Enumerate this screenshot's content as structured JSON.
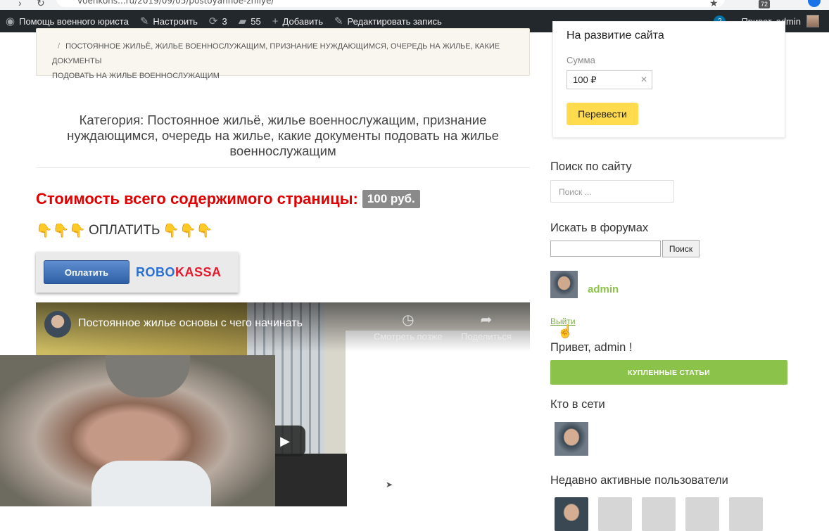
{
  "browser": {
    "url": "voenkons...ru/2019/09/05/postoyannoe-zhilye/",
    "extension_count": "72"
  },
  "admin_bar": {
    "site_name": "Помощь военного юриста",
    "customize": "Настроить",
    "updates": "3",
    "comments": "55",
    "add_new": "Добавить",
    "edit_post": "Редактировать запись",
    "notifications": "2",
    "greeting": "Привет, admin"
  },
  "breadcrumb": {
    "line1": "ПОСТОЯННОЕ ЖИЛЬЁ, ЖИЛЬЕ ВОЕННОСЛУЖАЩИМ, ПРИЗНАНИЕ НУЖДАЮЩИМСЯ, ОЧЕРЕДЬ НА ЖИЛЬЕ, КАКИЕ ДОКУМЕНТЫ",
    "line2": "ПОДОВАТЬ НА ЖИЛЬЕ ВОЕННОСЛУЖАЩИМ"
  },
  "category_title": "Категория: Постоянное жильё, жилье военнослужащим, признание нуждающимся, очередь на жилье, какие документы подовать на жилье военнослужащим",
  "cost": {
    "label": "Стоимость всего содержимого страницы:",
    "price": "100 руб."
  },
  "pay": {
    "label": "ОПЛАТИТЬ"
  },
  "robokassa": {
    "button": "Оплатить",
    "logo_a": "ROBO",
    "logo_b": "KASSA"
  },
  "video": {
    "title": "Постоянное жилье основы с чего начинать",
    "watch_later": "Смотреть позже",
    "share": "Поделиться"
  },
  "sidebar": {
    "donate_title": "На развитие сайта",
    "sum_label": "Сумма",
    "sum_value": "100 ₽",
    "transfer": "Перевести",
    "search_title": "Поиск по сайту",
    "search_placeholder": "Поиск ...",
    "forums_title": "Искать в форумах",
    "forums_button": "Поиск",
    "username": "admin",
    "logout": "Выйти",
    "hello": "Привет, admin !",
    "bought": "КУПЛЕННЫЕ СТАТЬИ",
    "online_title": "Кто в сети",
    "recent_title": "Недавно активные пользователи"
  }
}
